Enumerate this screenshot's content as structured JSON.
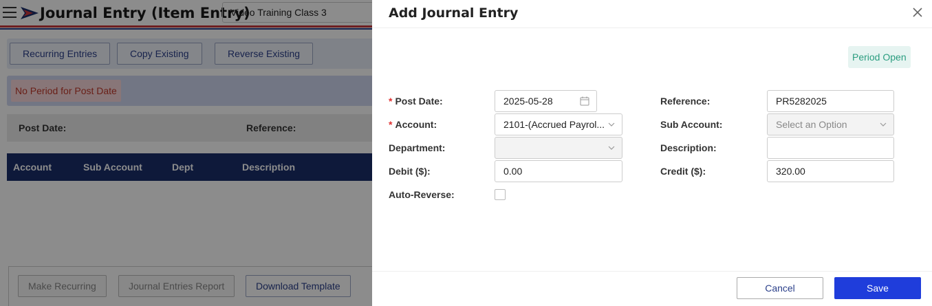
{
  "app": {
    "title": "Journal Entry (Item Entry)",
    "company": "Video Training Class 3"
  },
  "actions": {
    "recurring": "Recurring Entries",
    "copy": "Copy Existing",
    "reverse": "Reverse Existing"
  },
  "status": {
    "no_period": "No Period for Post Date"
  },
  "info": {
    "post_date_label": "Post Date:",
    "reference_label": "Reference:"
  },
  "table": {
    "headers": [
      "Account",
      "Sub Account",
      "Dept",
      "Description"
    ]
  },
  "bottom": {
    "make_recurring": "Make Recurring",
    "report": "Journal Entries Report",
    "download": "Download Template"
  },
  "drawer": {
    "title": "Add Journal Entry",
    "period_status": "Period Open",
    "fields": {
      "post_date": {
        "label": "Post Date:",
        "value": "2025-05-28"
      },
      "reference": {
        "label": "Reference:",
        "value": "PR5282025"
      },
      "account": {
        "label": "Account:",
        "value": "2101-(Accrued Payrol..."
      },
      "sub_account": {
        "label": "Sub Account:",
        "placeholder": "Select an Option"
      },
      "department": {
        "label": "Department:",
        "value": ""
      },
      "description": {
        "label": "Description:",
        "value": ""
      },
      "debit": {
        "label": "Debit ($):",
        "value": "0.00"
      },
      "credit": {
        "label": "Credit ($):",
        "value": "320.00"
      },
      "auto_reverse": {
        "label": "Auto-Reverse:",
        "checked": false
      }
    },
    "cancel": "Cancel",
    "save": "Save"
  },
  "colors": {
    "primary": "#1f3ddb",
    "nav": "#1a2e6b",
    "period_open": "#2a9d7f",
    "error": "#c0392b"
  }
}
